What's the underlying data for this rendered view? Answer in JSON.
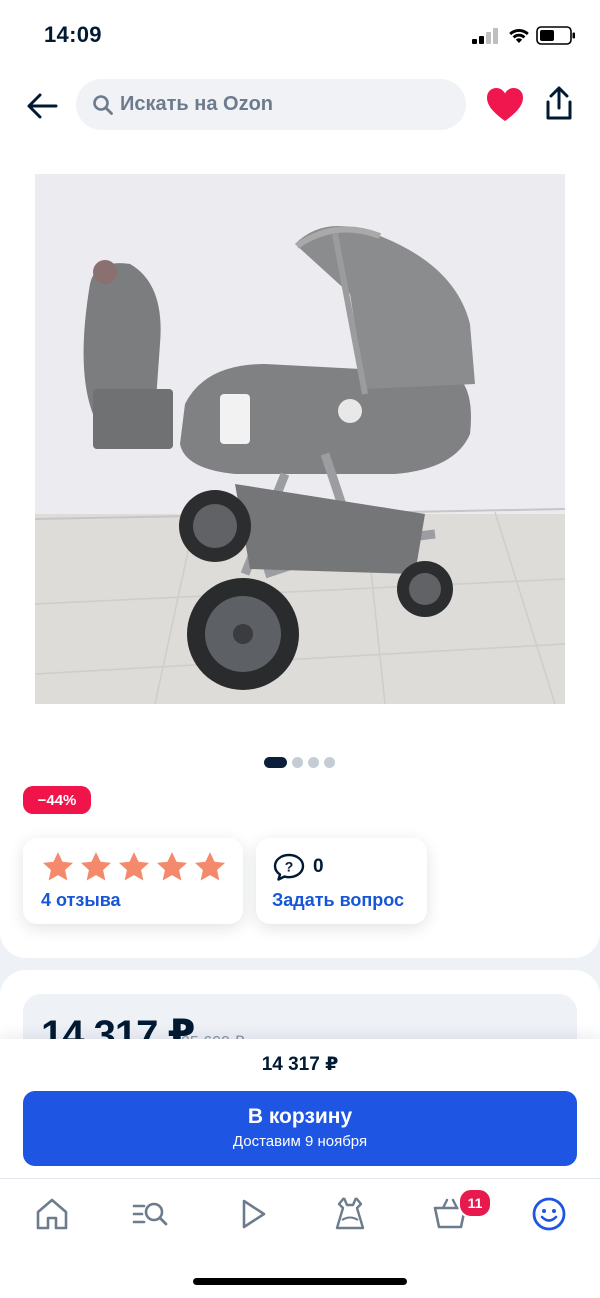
{
  "status_bar": {
    "time": "14:09"
  },
  "search": {
    "placeholder": "Искать на Ozon"
  },
  "product": {
    "image": "baby-stroller-photo",
    "gallery_pages": 4,
    "gallery_active_index": 0,
    "discount_badge": "−44%",
    "rating": 5,
    "reviews_label": "4 отзыва",
    "questions_count": "0",
    "ask_label": "Задать вопрос",
    "price_large": "14 317 ₽",
    "old_price": "25 600 ₽"
  },
  "buy_bar": {
    "price": "14 317 ₽",
    "cart_button_label": "В корзину",
    "delivery_label": "Доставим 9 ноября"
  },
  "tab_bar": {
    "items": [
      "home-icon",
      "catalog-search-icon",
      "video-play-icon",
      "fresh-dress-icon",
      "cart-icon",
      "profile-smile-icon"
    ],
    "cart_badge": "11",
    "active": "profile-smile-icon"
  },
  "colors": {
    "accent_blue": "#1e55e2",
    "link_blue": "#1756d6",
    "discount_red": "#f1144a",
    "heart_red": "#f0174e",
    "star_orange": "#f48a6b",
    "text_dark": "#001a34"
  }
}
